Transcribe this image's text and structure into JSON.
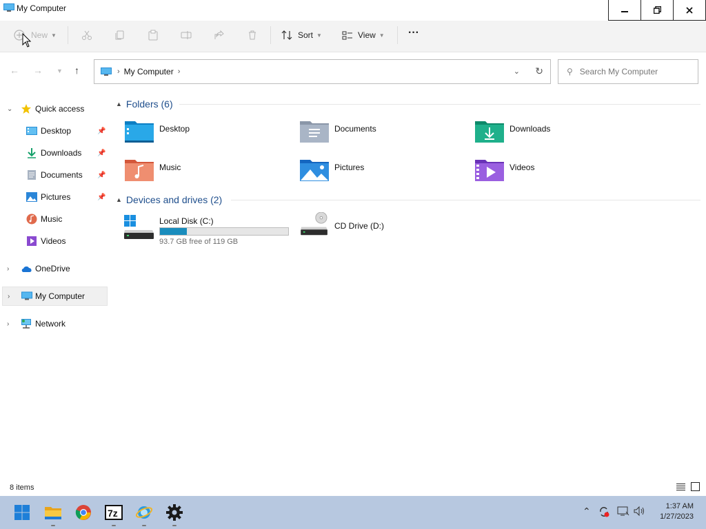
{
  "window": {
    "title": "My Computer",
    "minimize": "–",
    "restore": "❐",
    "close": "X"
  },
  "toolbar": {
    "new_label": "New",
    "sort_label": "Sort",
    "view_label": "View",
    "more_label": "···"
  },
  "address": {
    "crumb": "My Computer",
    "search_placeholder": "Search My Computer"
  },
  "sidebar": {
    "quick_access": "Quick access",
    "items": [
      {
        "label": "Desktop",
        "icon": "desktop-icon",
        "pinned": true
      },
      {
        "label": "Downloads",
        "icon": "downloads-icon",
        "pinned": true
      },
      {
        "label": "Documents",
        "icon": "documents-icon",
        "pinned": true
      },
      {
        "label": "Pictures",
        "icon": "pictures-icon",
        "pinned": true
      },
      {
        "label": "Music",
        "icon": "music-icon",
        "pinned": false
      },
      {
        "label": "Videos",
        "icon": "videos-icon",
        "pinned": false
      }
    ],
    "onedrive": "OneDrive",
    "my_computer": "My Computer",
    "network": "Network"
  },
  "content": {
    "folders_header": "Folders (6)",
    "folders": [
      {
        "label": "Desktop",
        "icon": "desktop-folder-icon"
      },
      {
        "label": "Documents",
        "icon": "documents-folder-icon"
      },
      {
        "label": "Downloads",
        "icon": "downloads-folder-icon"
      },
      {
        "label": "Music",
        "icon": "music-folder-icon"
      },
      {
        "label": "Pictures",
        "icon": "pictures-folder-icon"
      },
      {
        "label": "Videos",
        "icon": "videos-folder-icon"
      }
    ],
    "drives_header": "Devices and drives (2)",
    "drives": [
      {
        "label": "Local Disk (C:)",
        "free_text": "93.7 GB free of 119 GB",
        "used_fraction": 0.21
      },
      {
        "label": "CD Drive (D:)"
      }
    ]
  },
  "status": {
    "items_count": "8 items"
  },
  "taskbar": {
    "time": "1:37 AM",
    "date": "1/27/2023",
    "apps": [
      "start-icon",
      "file-explorer-icon",
      "chrome-icon",
      "7zip-icon",
      "ie-icon",
      "settings-icon"
    ]
  },
  "colors": {
    "accent": "#1a8dbd",
    "taskbar": "#b7c8e0",
    "group_header": "#1e4e8c"
  }
}
